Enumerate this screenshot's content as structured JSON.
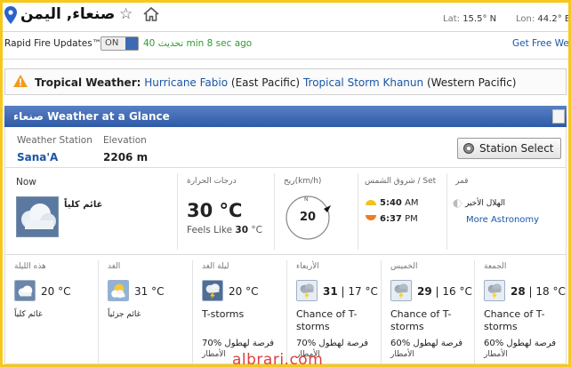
{
  "header": {
    "city": "صنعاء, اليمن",
    "lat_label": "Lat:",
    "lat_value": "15.5° N",
    "lon_label": "Lon:",
    "lon_value": "44.2° E"
  },
  "rapid_fire": {
    "label": "Rapid Fire Updates™",
    "toggle": "ON",
    "update_minutes": "40",
    "update_text": "تحديث",
    "update_ago": "min 8 sec ago",
    "free_link": "Get Free We"
  },
  "alert": {
    "title": "Tropical Weather:",
    "storm1": "Hurricane Fabio",
    "storm1_region": "(East Pacific)",
    "storm2": "Tropical Storm Khanun",
    "storm2_region": "(Western Pacific)"
  },
  "glance": {
    "city": "صنعاء",
    "title": "Weather at a Glance"
  },
  "station": {
    "station_label": "Weather Station",
    "station_value": "Sana'A",
    "elevation_label": "Elevation",
    "elevation_value": "2206 m",
    "button": "Station Select"
  },
  "current": {
    "now_label": "Now",
    "condition": "غائم كلياً",
    "temp_label": "درجات الحرارة",
    "temp": "30 °C",
    "feels_label": "Feels Like",
    "feels_value": "30",
    "feels_unit": "°C",
    "wind_label": "ريح(km/h)",
    "wind_dir": "N",
    "wind_speed": "20",
    "sun_label": "شروق الشمس / Set",
    "sunrise": "5:40",
    "sunrise_ampm": "AM",
    "sunset": "6:37",
    "sunset_ampm": "PM",
    "moon_label": "قمر",
    "moon_phase": "الهلال الأخير",
    "astronomy_link": "More Astronomy"
  },
  "forecast": [
    {
      "day": "هذه الليلة",
      "temps": "20 °C",
      "cond": "غائم كلياً",
      "icon": "cloudy-night-icon"
    },
    {
      "day": "الغد",
      "temps": "31 °C",
      "cond": "غائم جزئياً",
      "icon": "partly-cloudy-icon"
    },
    {
      "day": "ليلة الغد",
      "temps": "20 °C",
      "cond": "T-storms",
      "pop": "70%",
      "pop_label": "فرصة لهطول",
      "pop_label2": "الأمطار",
      "icon": "thunderstorm-icon"
    },
    {
      "day": "الأربعاء",
      "hi": "31",
      "lo": "17 °C",
      "cond": "Chance of T-storms",
      "pop": "70%",
      "pop_label": "فرصة لهطول",
      "pop_label2": "الأمطار",
      "icon": "thunderstorm-icon"
    },
    {
      "day": "الخميس",
      "hi": "29",
      "lo": "16 °C",
      "cond": "Chance of T-storms",
      "pop": "60%",
      "pop_label": "فرصة لهطول",
      "pop_label2": "الأمطار",
      "icon": "thunderstorm-icon"
    },
    {
      "day": "الجمعة",
      "hi": "28",
      "lo": "18 °C",
      "cond": "Chance of T-storms",
      "pop": "60%",
      "pop_label": "فرصة لهطول",
      "pop_label2": "الأمطار",
      "icon": "thunderstorm-icon"
    }
  ],
  "watermark": "albrari.com",
  "colors": {
    "accent": "#2f5aa6",
    "link": "#1a55a6",
    "update_green": "#2f9a2f",
    "frame": "#f7c81c"
  }
}
